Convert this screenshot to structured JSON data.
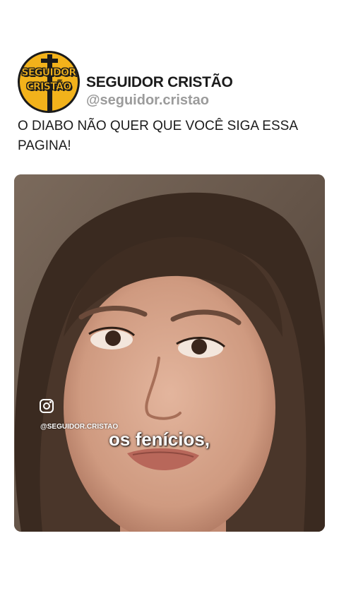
{
  "header": {
    "logo": {
      "line1": "SEGUIDOR",
      "line2": "CRISTÃO",
      "accent_color": "#f2b21b",
      "icon": "cross-icon"
    },
    "name": "SEGUIDOR CRISTÃO",
    "handle": "@seguidor.cristao"
  },
  "post": {
    "caption": "O DIABO NÃO QUER QUE VOCÊ SIGA ESSA PAGINA!"
  },
  "video": {
    "watermark_icon": "instagram-icon",
    "watermark_handle": "@SEGUIDOR.CRISTAO",
    "subtitle": "os fenícios,"
  }
}
